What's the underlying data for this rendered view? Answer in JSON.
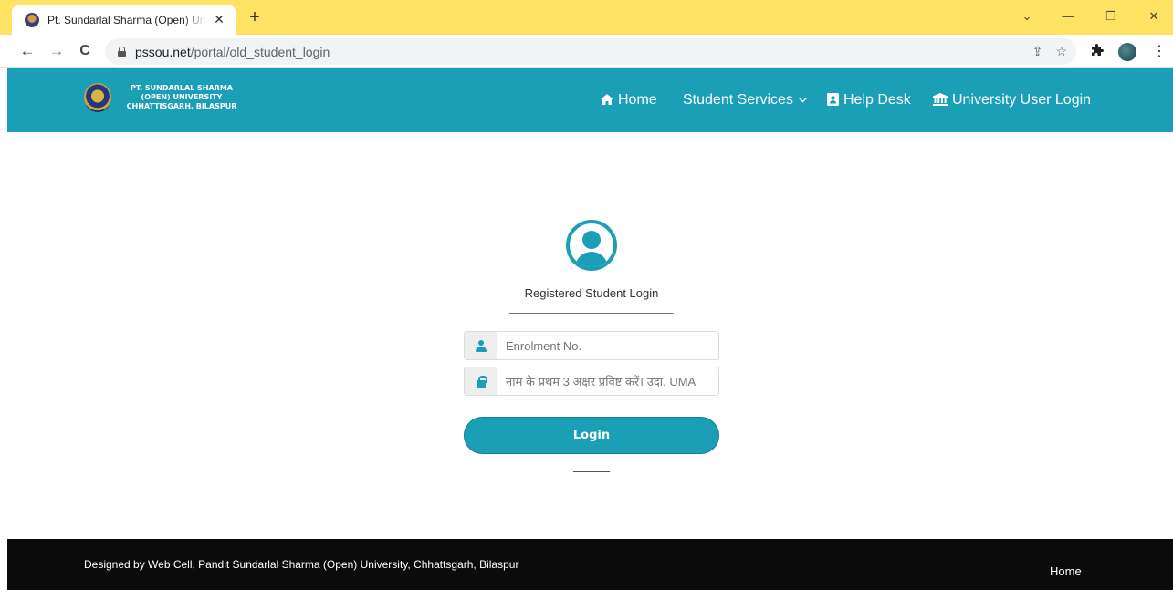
{
  "browser": {
    "tab_title": "Pt. Sundarlal Sharma (Open) Univ",
    "tab_close": "✕",
    "new_tab": "+",
    "url_host": "pssou.net",
    "url_path": "/portal/old_student_login",
    "window_controls": {
      "minimize": "—",
      "restore": "❐",
      "close": "✕",
      "menu": "⌄"
    },
    "nav": {
      "back": "←",
      "forward": "→",
      "reload": "C"
    },
    "omnibox_icons": {
      "share": "⇪",
      "bookmark": "☆"
    },
    "extensions_icon": "puzzle-icon",
    "menu_dots": "⋮"
  },
  "header": {
    "logo_lines": [
      "PT. SUNDARLAL SHARMA",
      "(OPEN) UNIVERSITY",
      "CHHATTISGARH, BILASPUR"
    ],
    "nav": {
      "home": "Home",
      "student_services": "Student Services",
      "help_desk": "Help Desk",
      "university_login": "University User Login"
    },
    "brand_color": "#1a9fb6"
  },
  "login": {
    "title": "Registered Student Login",
    "enrolment_placeholder": "Enrolment No.",
    "name_placeholder": "नाम के प्रथम 3 अक्षर प्रविष्ट करें। उदा. UMA",
    "button": "Login"
  },
  "footer": {
    "credit": "Designed by Web Cell, Pandit Sundarlal Sharma (Open) University, Chhattsgarh, Bilaspur",
    "home": "Home"
  }
}
